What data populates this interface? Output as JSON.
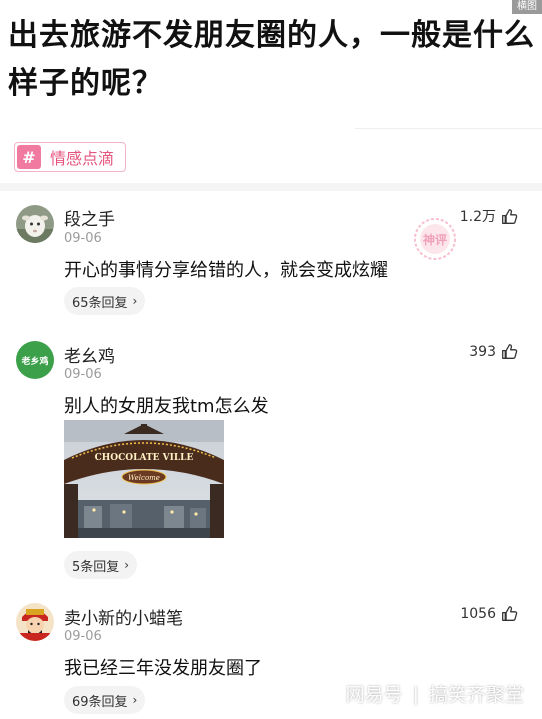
{
  "corner_label": "横图",
  "title": "出去旅游不发朋友圈的人，一般是什么样子的呢？",
  "topic": {
    "hash": "#",
    "label": "情感点滴"
  },
  "stamp_text": "神评",
  "comments": [
    {
      "username": "段之手",
      "date": "09-06",
      "text": "开心的事情分享给错的人，就会变成炫耀",
      "likes": "1.2万",
      "replies": "65条回复"
    },
    {
      "username": "老幺鸡",
      "avatar_text": "老乡鸡",
      "date": "09-06",
      "text": "别人的女朋友我tm怎么发",
      "likes": "393",
      "replies": "5条回复",
      "photo": {
        "sign_text": "CHOCOLATE VILLE",
        "welcome_text": "Welcome"
      }
    },
    {
      "username": "卖小新的小蜡笔",
      "date": "09-06",
      "text": "我已经三年没发朋友圈了",
      "likes": "1056",
      "replies": "69条回复"
    }
  ],
  "footer": {
    "brand": "网易号",
    "channel": "搞笑齐聚堂"
  },
  "colors": {
    "topic_pink": "#e5547f",
    "avatar_green": "#3ca04a",
    "date_gray": "#9b9b9b"
  }
}
